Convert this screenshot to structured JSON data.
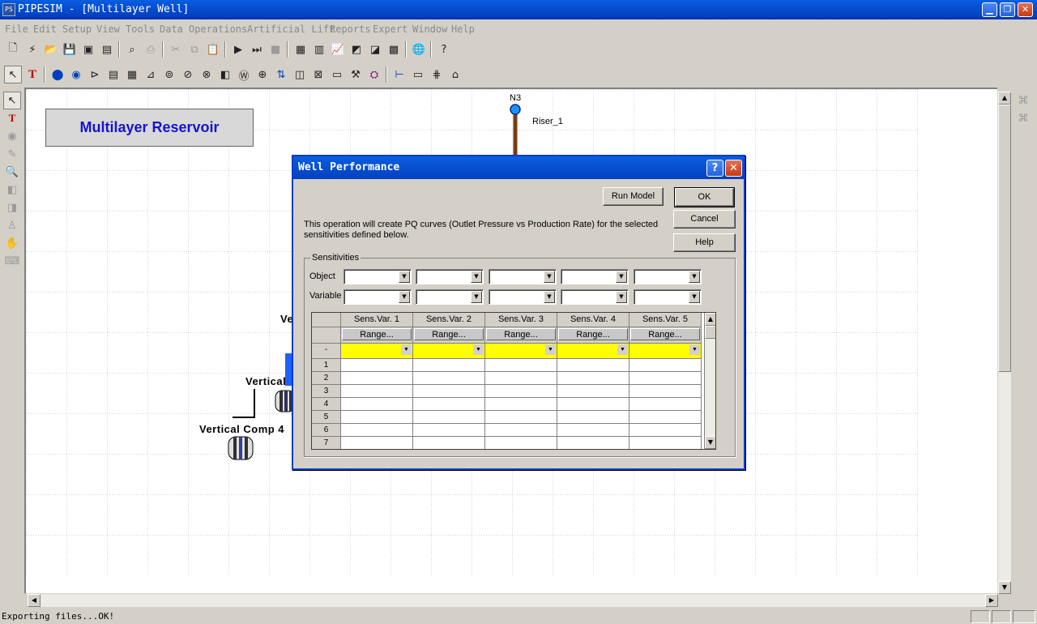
{
  "window": {
    "title": "PIPESIM - [Multilayer Well]"
  },
  "menu": [
    "File",
    "Edit",
    "Setup",
    "View",
    "Tools",
    "Data",
    "Operations",
    "Artificial Lift",
    "Reports",
    "Expert",
    "Window",
    "Help"
  ],
  "canvas": {
    "title_box": "Multilayer Reservoir",
    "node_label": "N3",
    "riser_label": "Riser_1",
    "comp_labels": {
      "partial_top": "Ve",
      "partial_mid": "Vertical",
      "comp4": "Vertical Comp 4"
    }
  },
  "dialog": {
    "title": "Well Performance",
    "help_q": "?",
    "close_x": "✕",
    "run_model": "Run Model",
    "ok": "OK",
    "cancel": "Cancel",
    "help": "Help",
    "description": "This operation will create PQ curves (Outlet Pressure vs Production Rate) for the selected sensitivities defined below.",
    "group_label": "Sensitivities",
    "object_label": "Object",
    "variable_label": "Variable",
    "grid": {
      "headers": [
        "Sens.Var. 1",
        "Sens.Var. 2",
        "Sens.Var. 3",
        "Sens.Var. 4",
        "Sens.Var. 5"
      ],
      "range_label": "Range...",
      "dash": "-",
      "rows": [
        "1",
        "2",
        "3",
        "4",
        "5",
        "6",
        "7"
      ]
    }
  },
  "status": {
    "text": "Exporting files...OK!"
  },
  "colors": {
    "title_box_text": "#1414d0",
    "yellow_row": "#ffff00",
    "titlebar": "#0848d0"
  }
}
